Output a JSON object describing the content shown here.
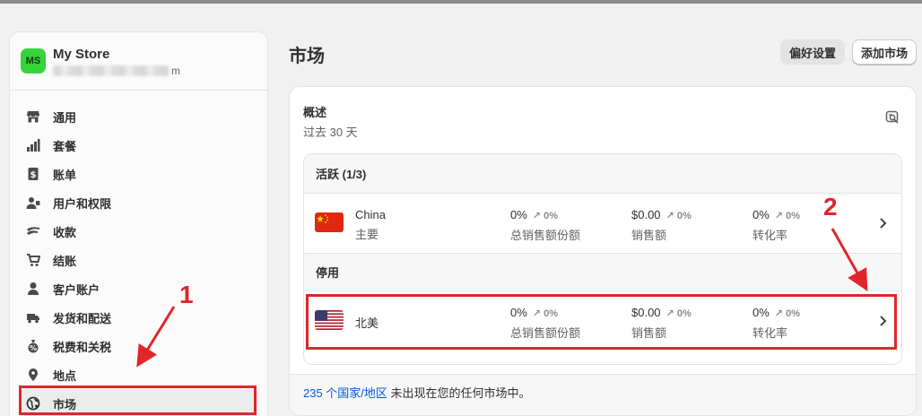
{
  "store": {
    "avatar_initials": "MS",
    "name": "My Store",
    "domain_suffix": "m"
  },
  "sidebar": {
    "items": [
      {
        "label": "通用",
        "icon": "store-icon"
      },
      {
        "label": "套餐",
        "icon": "plan-chart-icon"
      },
      {
        "label": "账单",
        "icon": "billing-icon"
      },
      {
        "label": "用户和权限",
        "icon": "users-icon"
      },
      {
        "label": "收款",
        "icon": "payments-icon"
      },
      {
        "label": "结账",
        "icon": "cart-icon"
      },
      {
        "label": "客户账户",
        "icon": "person-icon"
      },
      {
        "label": "发货和配送",
        "icon": "truck-icon"
      },
      {
        "label": "税费和关税",
        "icon": "tax-icon"
      },
      {
        "label": "地点",
        "icon": "location-pin-icon"
      },
      {
        "label": "市场",
        "icon": "globe-icon"
      }
    ]
  },
  "header": {
    "title": "市场",
    "preferences_button": "偏好设置",
    "add_market_button": "添加市场"
  },
  "overview": {
    "title": "概述",
    "subtitle": "过去 30 天"
  },
  "sections": {
    "active_header": "活跃 (1/3)",
    "disabled_header": "停用"
  },
  "markets": [
    {
      "name": "China",
      "tag": "主要",
      "metrics": [
        {
          "value": "0%",
          "change": "↗ 0%",
          "label": "总销售额份额"
        },
        {
          "value": "$0.00",
          "change": "↗ 0%",
          "label": "销售额"
        },
        {
          "value": "0%",
          "change": "↗ 0%",
          "label": "转化率"
        }
      ]
    },
    {
      "name": "北美",
      "tag": "",
      "metrics": [
        {
          "value": "0%",
          "change": "↗ 0%",
          "label": "总销售额份额"
        },
        {
          "value": "$0.00",
          "change": "↗ 0%",
          "label": "销售额"
        },
        {
          "value": "0%",
          "change": "↗ 0%",
          "label": "转化率"
        }
      ]
    }
  ],
  "footer": {
    "link": "235 个国家/地区",
    "text": " 未出现在您的任何市场中。"
  },
  "annotations": {
    "label_1": "1",
    "label_2": "2",
    "color": "#e0262a"
  }
}
